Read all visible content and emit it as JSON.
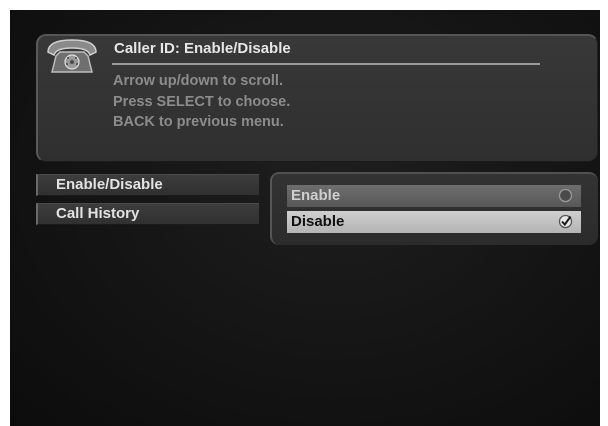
{
  "header": {
    "title": "Caller ID: Enable/Disable",
    "icon": "telephone-icon",
    "instructions": [
      "Arrow up/down to scroll.",
      "Press SELECT to choose.",
      "BACK to previous menu."
    ]
  },
  "menu": {
    "items": [
      {
        "label": "Enable/Disable",
        "active": true
      },
      {
        "label": "Call History",
        "active": false
      }
    ]
  },
  "options": {
    "items": [
      {
        "label": "Enable",
        "checked": false,
        "icon": "radio-empty-icon"
      },
      {
        "label": "Disable",
        "checked": true,
        "icon": "radio-checked-icon"
      }
    ],
    "selected_index": 1
  },
  "colors": {
    "background": "#141414",
    "panel": "#333333",
    "highlight": "#c4c4c4",
    "title_text": "#e6e6e6",
    "instruction_text": "#8c8c8c"
  }
}
